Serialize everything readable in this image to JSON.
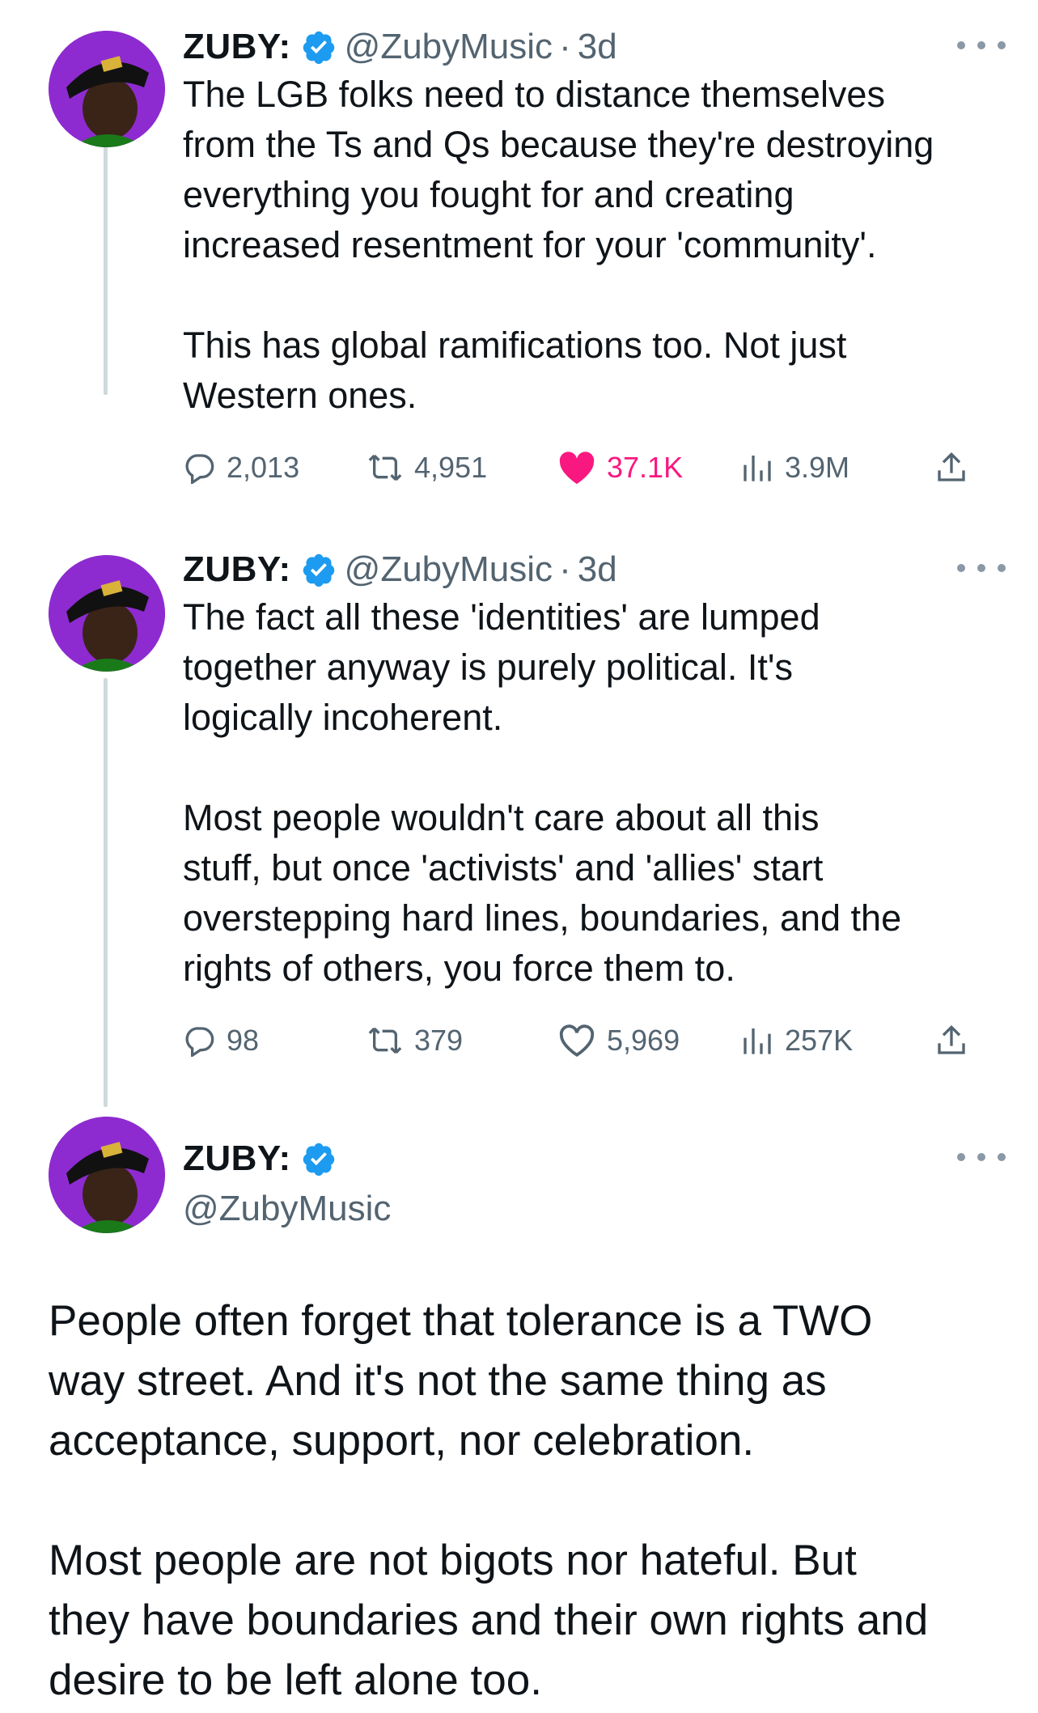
{
  "tweets": [
    {
      "name": "ZUBY:",
      "handle": "@ZubyMusic",
      "separator": "·",
      "time": "3d",
      "text": "The LGB folks need to distance themselves\nfrom the Ts and Qs because they're destroying\neverything you fought for and creating\nincreased resentment for your 'community'.\n\nThis has global ramifications too. Not just\nWestern ones.",
      "replies": "2,013",
      "retweets": "4,951",
      "likes": "37.1K",
      "views": "3.9M",
      "liked": true
    },
    {
      "name": "ZUBY:",
      "handle": "@ZubyMusic",
      "separator": "·",
      "time": "3d",
      "text": "The fact all these 'identities' are lumped\ntogether anyway is purely political. It's\nlogically incoherent.\n\nMost people wouldn't care about all this\nstuff, but once 'activists' and 'allies' start\noverstepping hard lines, boundaries, and the\nrights of others, you force them to.",
      "replies": "98",
      "retweets": "379",
      "likes": "5,969",
      "views": "257K",
      "liked": false
    },
    {
      "name": "ZUBY:",
      "handle": "@ZubyMusic",
      "text": "People often forget that tolerance is a TWO\nway street. And it's not the same thing as\nacceptance, support, nor celebration.\n\nMost people are not bigots nor hateful. But\nthey have boundaries and their own rights and\ndesire to be left alone too."
    }
  ],
  "icons": {
    "reply": "reply-icon",
    "retweet": "retweet-icon",
    "like": "heart-icon",
    "views": "views-icon",
    "share": "share-icon",
    "verified": "verified-badge-icon",
    "more": "more-icon"
  },
  "colors": {
    "verified": "#1d9bf0",
    "like_active": "#f91880",
    "muted": "#536471",
    "thread_line": "#cfd9de",
    "avatar_bg": "#7a1fb0"
  }
}
